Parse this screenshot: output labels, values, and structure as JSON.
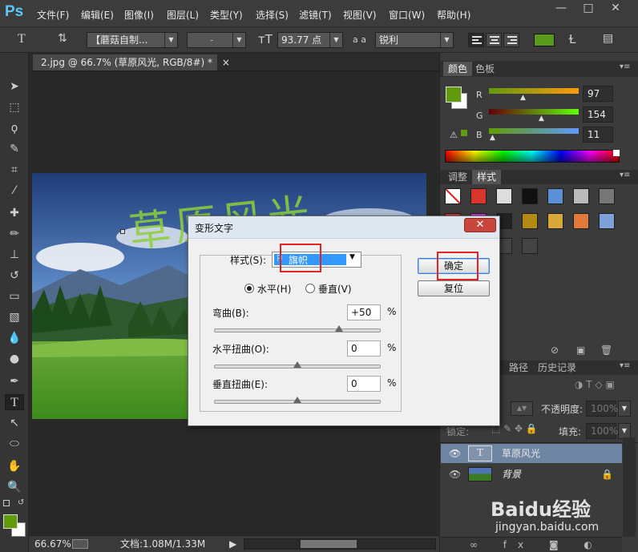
{
  "app": {
    "logo": "Ps"
  },
  "menu": [
    "文件(F)",
    "编辑(E)",
    "图像(I)",
    "图层(L)",
    "类型(Y)",
    "选择(S)",
    "滤镜(T)",
    "视图(V)",
    "窗口(W)",
    "帮助(H)"
  ],
  "window_controls": {
    "minimize": "—",
    "restore": "□",
    "close": "✕"
  },
  "options_bar": {
    "tool_glyph": "T",
    "font_family": "【蘑菇自制...",
    "font_style": "-",
    "font_size": "93.77 点",
    "aa_label": "a a",
    "antialias": "锐利",
    "text_color": "#5a9a1a"
  },
  "document": {
    "tab_title": "2.jpg @ 66.7% (草原风光, RGB/8#) *",
    "close": "×"
  },
  "status_bar": {
    "zoom": "66.67%",
    "doc_size": "文档:1.08M/1.33M"
  },
  "color_panel": {
    "tabs": [
      "颜色",
      "色板"
    ],
    "r_label": "R",
    "g_label": "G",
    "b_label": "B",
    "r": "97",
    "g": "154",
    "b": "11",
    "fg_color": "#619a0b"
  },
  "styles_panel": {
    "tabs": [
      "调整",
      "样式"
    ]
  },
  "layers_panel": {
    "tabs": [
      "路径",
      "历史记录"
    ],
    "opacity_label": "不透明度:",
    "opacity": "100%",
    "lock_label": "锁定:",
    "fill_label": "填充:",
    "fill": "100%",
    "layers": [
      {
        "name": "草原风光",
        "type": "text"
      },
      {
        "name": "背景",
        "type": "image"
      }
    ]
  },
  "canvas": {
    "text_overlay": "草原风光"
  },
  "dialog": {
    "title": "变形文字",
    "close": "✕",
    "style_label": "样式(S):",
    "style_value": "旗帜",
    "horizontal_label": "水平(H)",
    "vertical_label": "垂直(V)",
    "bend_label": "弯曲(B):",
    "bend_value": "+50",
    "hdist_label": "水平扭曲(O):",
    "hdist_value": "0",
    "vdist_label": "垂直扭曲(E):",
    "vdist_value": "0",
    "percent": "%",
    "ok": "确定",
    "reset": "复位",
    "bend_level": 0.75,
    "hdist_level": 0.5,
    "vdist_level": 0.5
  },
  "watermark": {
    "brand": "Baidu经验",
    "url": "jingyan.baidu.com"
  }
}
